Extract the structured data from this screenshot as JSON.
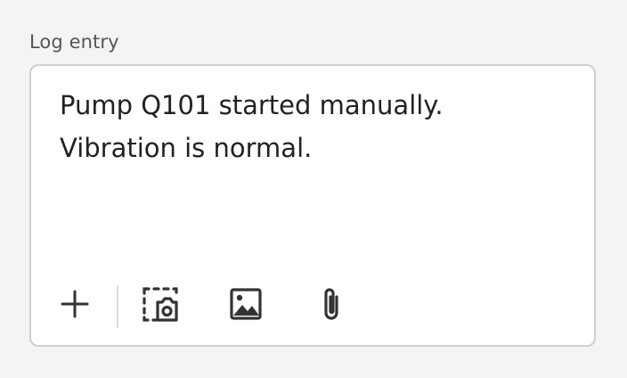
{
  "field": {
    "label": "Log entry",
    "value": "Pump Q101 started manually.\nVibration is normal."
  },
  "toolbar": {
    "buttons": [
      {
        "icon": "plus-icon"
      },
      {
        "icon": "camera-capture-icon"
      },
      {
        "icon": "image-icon"
      },
      {
        "icon": "paperclip-icon"
      }
    ]
  },
  "colors": {
    "background": "#f4f4f4",
    "box_border": "#cfcfcf",
    "text": "#222222",
    "label": "#555555",
    "icon": "#333333"
  }
}
